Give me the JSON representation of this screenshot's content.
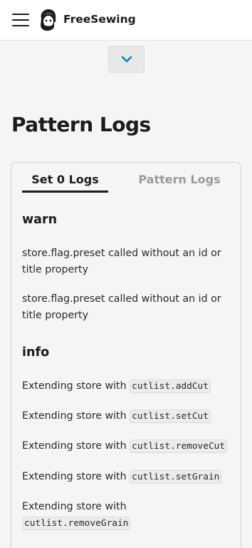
{
  "header": {
    "brand": "FreeSewing"
  },
  "page": {
    "title": "Pattern Logs"
  },
  "tabs": [
    {
      "label": "Set 0 Logs",
      "active": true
    },
    {
      "label": "Pattern Logs",
      "active": false
    }
  ],
  "logs": {
    "warn": {
      "heading": "warn",
      "lines": [
        "store.flag.preset called without an id or title property",
        "store.flag.preset called without an id or title property"
      ]
    },
    "info": {
      "heading": "info",
      "prefix": "Extending store with",
      "lines": [
        {
          "text": "Extending store with",
          "code": "cutlist.addCut"
        },
        {
          "text": "Extending store with",
          "code": "cutlist.setCut"
        },
        {
          "text": "Extending store with",
          "code": "cutlist.removeCut"
        },
        {
          "text": "Extending store with",
          "code": "cutlist.setGrain"
        },
        {
          "text": "Extending store with",
          "code": "cutlist.removeGrain"
        }
      ]
    }
  },
  "colors": {
    "accent": "#0284c7",
    "text": "#1c1c1c",
    "muted": "#9a9a9a"
  },
  "icons": {
    "menu": "hamburger-menu-icon",
    "logo": "freesewing-logo-icon",
    "collapse": "chevron-down-icon"
  }
}
